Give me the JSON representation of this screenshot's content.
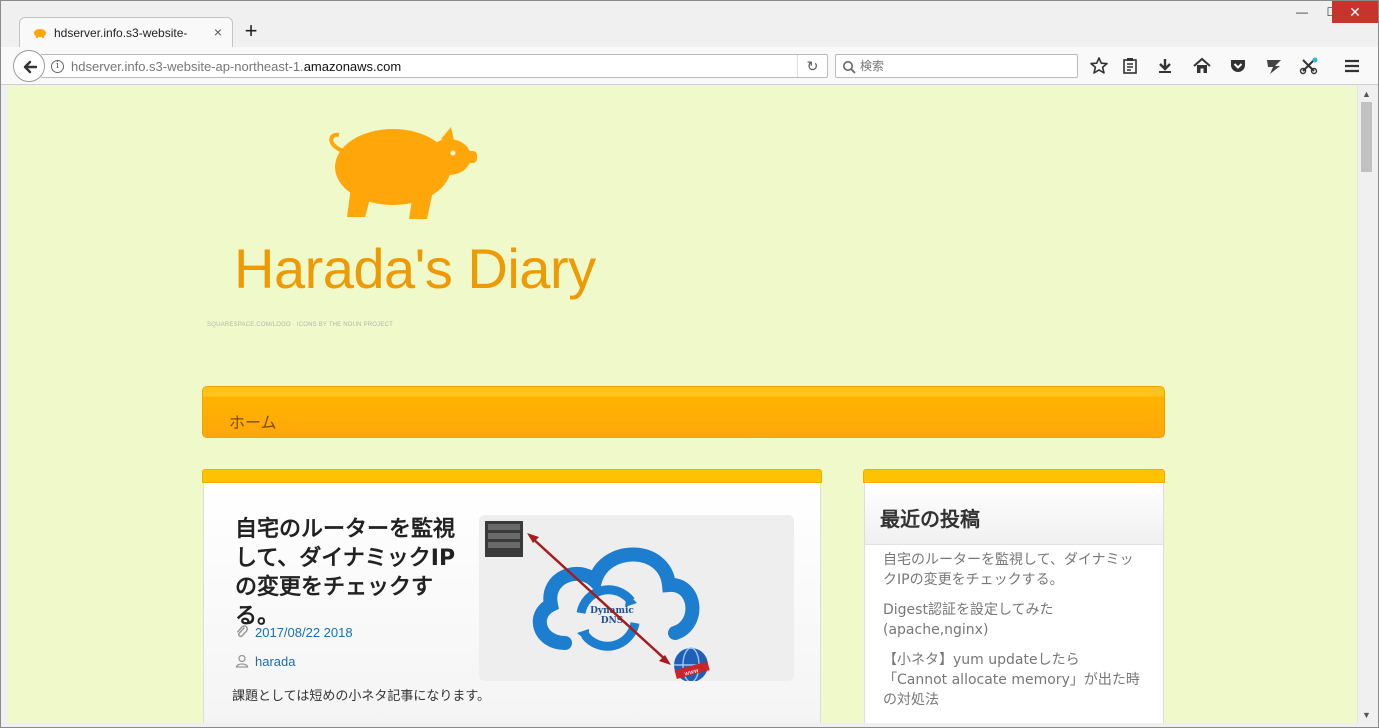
{
  "browser": {
    "tab_title": "hdserver.info.s3-website-",
    "new_tab_label": "+",
    "url_prefix": "hdserver.info.s3-website-ap-northeast-1.",
    "url_domain": "amazonaws.com",
    "search_placeholder": "検索",
    "window_minimize": "—",
    "window_maximize": "☐",
    "window_close": "✕",
    "tab_close": "×",
    "reload_glyph": "↻",
    "info_glyph": "i",
    "toolbar_icons": [
      "star-icon",
      "reading-list-icon",
      "download-icon",
      "home-icon",
      "pocket-icon",
      "extension-icon",
      "puzzle-icon",
      "menu-icon"
    ]
  },
  "site": {
    "title": "Harada's Diary",
    "logo_credit": "SQUARESPACE.COM/LOGO · ICONS BY THE NOUN PROJECT",
    "accent": "#ffa70a",
    "title_color": "#ee9a04",
    "background": "#eff9c9"
  },
  "menu": {
    "items": [
      "ホーム"
    ]
  },
  "post": {
    "title": "自宅のルーターを監視して、ダイナミックIPの変更をチェックする。",
    "date": "2017/08/22 2018",
    "author": "harada",
    "excerpt": "課題としては短めの小ネタ記事になります。",
    "thumb_label_1": "Dynamic",
    "thumb_label_2": "DNS",
    "thumb_badge": "www"
  },
  "sidebar": {
    "title": "最近の投稿",
    "recent_posts": [
      "自宅のルーターを監視して、ダイナミックIPの変更をチェックする。",
      "Digest認証を設定してみた(apache,nginx)",
      "【小ネタ】yum updateしたら「Cannot allocate memory」が出た時の対処法"
    ]
  }
}
